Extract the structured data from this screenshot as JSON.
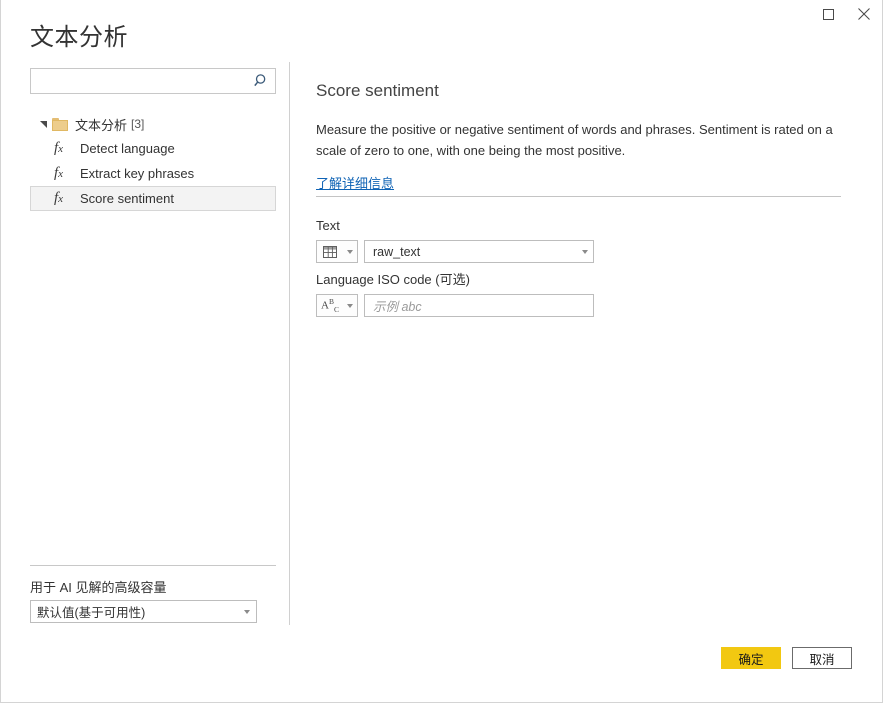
{
  "window": {
    "title": "文本分析",
    "maximize_icon": "maximize-icon",
    "close_icon": "close-icon"
  },
  "search": {
    "value": "",
    "placeholder": "",
    "icon": "search-icon"
  },
  "tree": {
    "group": {
      "label": "文本分析",
      "count": "[3]",
      "icon": "folder-icon",
      "twisty": "expanded-triangle-icon"
    },
    "items": [
      {
        "label": "Detect language",
        "icon": "function-fx-icon",
        "selected": false
      },
      {
        "label": "Extract key phrases",
        "icon": "function-fx-icon",
        "selected": false
      },
      {
        "label": "Score sentiment",
        "icon": "function-fx-icon",
        "selected": true
      }
    ]
  },
  "capacity": {
    "label": "用于 AI 见解的高级容量",
    "selected": "默认值(基于可用性)",
    "chevron_icon": "chevron-down-icon"
  },
  "detail": {
    "title": "Score sentiment",
    "description": "Measure the positive or negative sentiment of words and phrases. Sentiment is rated on a scale of zero to one, with one being the most positive.",
    "learn_more": "了解详细信息"
  },
  "fields": [
    {
      "label": "Text",
      "type_icon": "table-column-icon",
      "value": "raw_text",
      "placeholder": "",
      "chevron_icon": "chevron-down-icon"
    },
    {
      "label": "Language ISO code (可选)",
      "type_icon": "abc-text-icon",
      "value": "",
      "placeholder": "示例 abc",
      "chevron_icon": "chevron-down-icon"
    }
  ],
  "footer": {
    "ok_label": "确定",
    "cancel_label": "取消"
  },
  "colors": {
    "accent_yellow": "#F2C811",
    "link_blue": "#0F63B5",
    "folder_gold": "#EDCD8C",
    "selected_row": "#F3F3F3"
  }
}
